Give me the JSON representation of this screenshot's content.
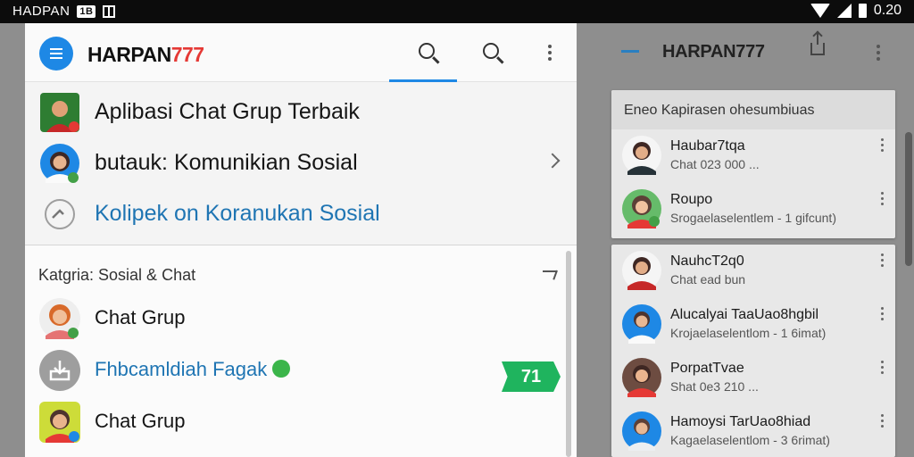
{
  "status_bar": {
    "left_text": "HADPAN",
    "badge": "1B",
    "time": "0.20"
  },
  "left_panel": {
    "brand_main": "HARPAN",
    "brand_accent": "777",
    "featured": [
      {
        "text": "Aplibasi Chat Grup Terbaik"
      },
      {
        "text": "butauk: Komunikian Sosial"
      },
      {
        "text": "Kolipek on Koranukan Sosial"
      }
    ],
    "category_label": "Katgria: Sosial & Chat",
    "contacts": [
      {
        "text": "Chat Grup"
      },
      {
        "text": "Fhbcamldiah Fagak"
      },
      {
        "text": "Chat Grup"
      }
    ],
    "promo_label": "71"
  },
  "right_panel": {
    "brand": "HARPAN777",
    "card1": {
      "header": "Eneo Kapirasen ohesumbiuas",
      "rows": [
        {
          "name": "Haubar7tqa",
          "sub": "Chat 023 000 ..."
        },
        {
          "name": "Roupo",
          "sub": "Srogaelaselentlem - 1 gifcunt)"
        }
      ]
    },
    "card2": {
      "rows": [
        {
          "name": "NauhcT2q0",
          "sub": "Chat ead bun"
        },
        {
          "name": "Alucalyai TaaUao8hgbil",
          "sub": "Krojaelaselentlom - 1 6imat)"
        },
        {
          "name": "PorpatTvae",
          "sub": "Shat 0e3 210 ..."
        },
        {
          "name": "Hamoysi TarUao8hiad",
          "sub": "Kagaelaselentlom - 3 6rimat)"
        }
      ]
    }
  },
  "colors": {
    "primary_blue": "#1e88e5",
    "link_blue": "#1f75b3",
    "brand_red": "#e53935",
    "promo_green": "#1fb45e"
  }
}
